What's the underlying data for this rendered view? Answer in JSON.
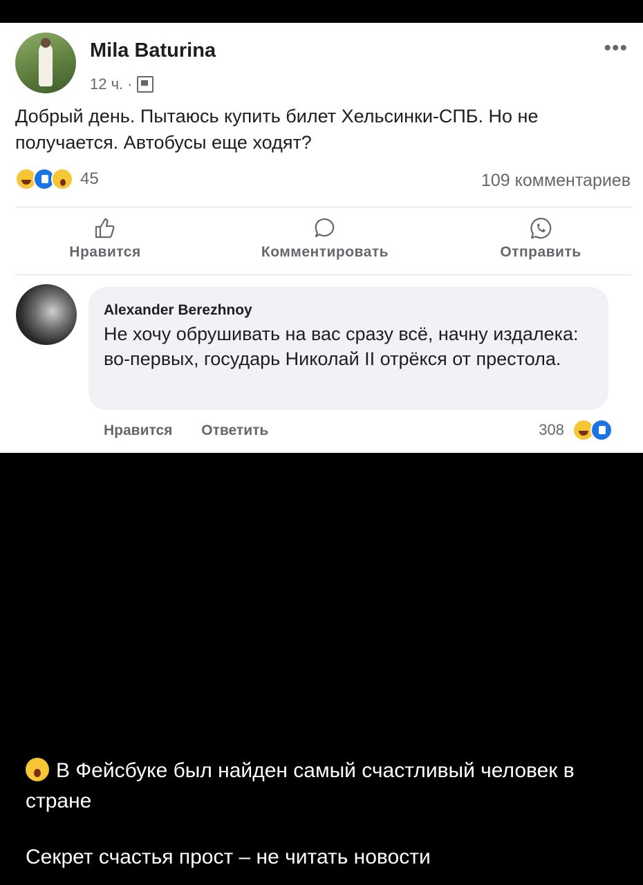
{
  "post": {
    "author": "Mila Baturina",
    "time": "12 ч.",
    "separator": "·",
    "more_label": "•••",
    "text": "Добрый день. Пытаюсь купить билет Хельсинки-СПБ. Но не получается. Автобусы еще ходят?",
    "reactions": {
      "icons": [
        "haha-icon",
        "like-icon",
        "wow-icon"
      ],
      "count": "45"
    },
    "comments_count": "109 комментариев",
    "actions": {
      "like": "Нравится",
      "comment": "Комментировать",
      "share": "Отправить"
    }
  },
  "comment": {
    "author": "Alexander Berezhnoy",
    "text": "Не хочу обрушивать на вас сразу всё, начну издалека: во-первых, государь Николай II отрёкся от престола.",
    "like_label": "Нравится",
    "reply_label": "Ответить",
    "reactions": {
      "icons": [
        "haha-icon",
        "like-icon"
      ],
      "count": "308"
    }
  },
  "caption": {
    "emoji": "wow-face-icon",
    "line1": "В Фейсбуке был найден самый счастливый человек в стране",
    "line2": "Секрет счастья прост – не читать новости"
  },
  "colors": {
    "like_blue": "#1b74e4",
    "text": "#1c1e21",
    "secondary": "#65676b",
    "bubble": "#f0f2f5"
  }
}
